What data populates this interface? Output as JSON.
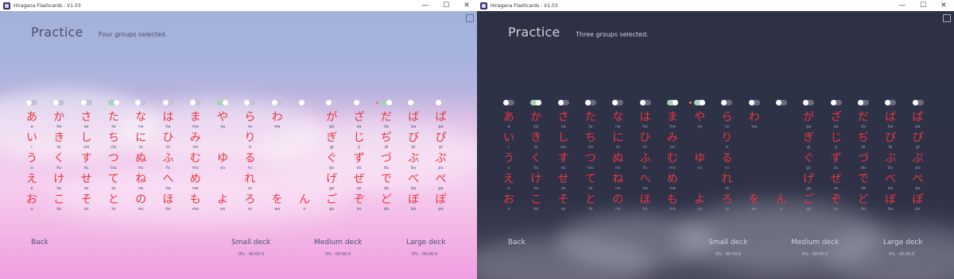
{
  "colors": {
    "kana_red": "#e8373f",
    "left_text": "#4b5070",
    "right_text": "#cfd1da",
    "toggle_off_left": "#c6c0d6",
    "toggle_on": "#a8d2b8",
    "toggle_off_right": "#6a6b7c"
  },
  "kana_columns": [
    [
      "あ a",
      "い i",
      "う u",
      "え e",
      "お o"
    ],
    [
      "か ka",
      "き ki",
      "く ku",
      "け ke",
      "こ ko"
    ],
    [
      "さ sa",
      "し shi",
      "す su",
      "せ se",
      "そ so"
    ],
    [
      "た ta",
      "ち chi",
      "つ tsu",
      "て te",
      "と to"
    ],
    [
      "な na",
      "に ni",
      "ぬ nu",
      "ね ne",
      "の no"
    ],
    [
      "は ha",
      "ひ hi",
      "ふ fu",
      "へ he",
      "ほ ho"
    ],
    [
      "ま ma",
      "み mi",
      "む mu",
      "め me",
      "も mo"
    ],
    [
      "や ya",
      "",
      "ゆ yu",
      "",
      "よ yo"
    ],
    [
      "ら ra",
      "り ri",
      "る ru",
      "れ re",
      "ろ ro"
    ],
    [
      "わ wa",
      "",
      "",
      "",
      "を wo"
    ],
    [
      "",
      "",
      "",
      "",
      "ん n"
    ],
    [
      "が ga",
      "ぎ gi",
      "ぐ gu",
      "げ ge",
      "ご go"
    ],
    [
      "ざ za",
      "じ ji",
      "ず zu",
      "ぜ ze",
      "ぞ zo"
    ],
    [
      "だ da",
      "ぢ di",
      "づ du",
      "で de",
      "ど do"
    ],
    [
      "ば ba",
      "び bi",
      "ぶ bu",
      "べ be",
      "ぼ bo"
    ],
    [
      "ぱ pa",
      "ぴ pi",
      "ぷ pu",
      "ぺ pe",
      "ぽ po"
    ]
  ],
  "windows": [
    {
      "id": "left",
      "title": "Hiragana Flashcards - V1.03",
      "controls": {
        "minimize": "—",
        "maximize": "☐",
        "close": "✕"
      },
      "heading": "Practice",
      "subheading": "Four groups selected.",
      "toggles": [
        false,
        false,
        false,
        true,
        false,
        false,
        false,
        true,
        false,
        false,
        false,
        false,
        false,
        true,
        false,
        false
      ],
      "selected_marker": 13,
      "back_label": "Back",
      "decks": [
        {
          "label": "Small deck",
          "stat": "0% - 00:00.0"
        },
        {
          "label": "Medium deck",
          "stat": "0% - 00:00.0"
        },
        {
          "label": "Large deck",
          "stat": "0% - 00:00.0"
        }
      ]
    },
    {
      "id": "right",
      "title": "Hiragana Flashcards - V1.03",
      "controls": {
        "minimize": "—",
        "maximize": "☐",
        "close": "✕"
      },
      "heading": "Practice",
      "subheading": "Three groups selected.",
      "toggles": [
        false,
        true,
        false,
        false,
        false,
        false,
        true,
        true,
        false,
        false,
        false,
        false,
        false,
        false,
        false,
        false
      ],
      "selected_marker": 7,
      "back_label": "Back",
      "decks": [
        {
          "label": "Small deck",
          "stat": "0% - 00:00.0"
        },
        {
          "label": "Medium deck",
          "stat": "0% - 00:00.0"
        },
        {
          "label": "Large deck",
          "stat": "0% - 00:00.0"
        }
      ]
    }
  ]
}
